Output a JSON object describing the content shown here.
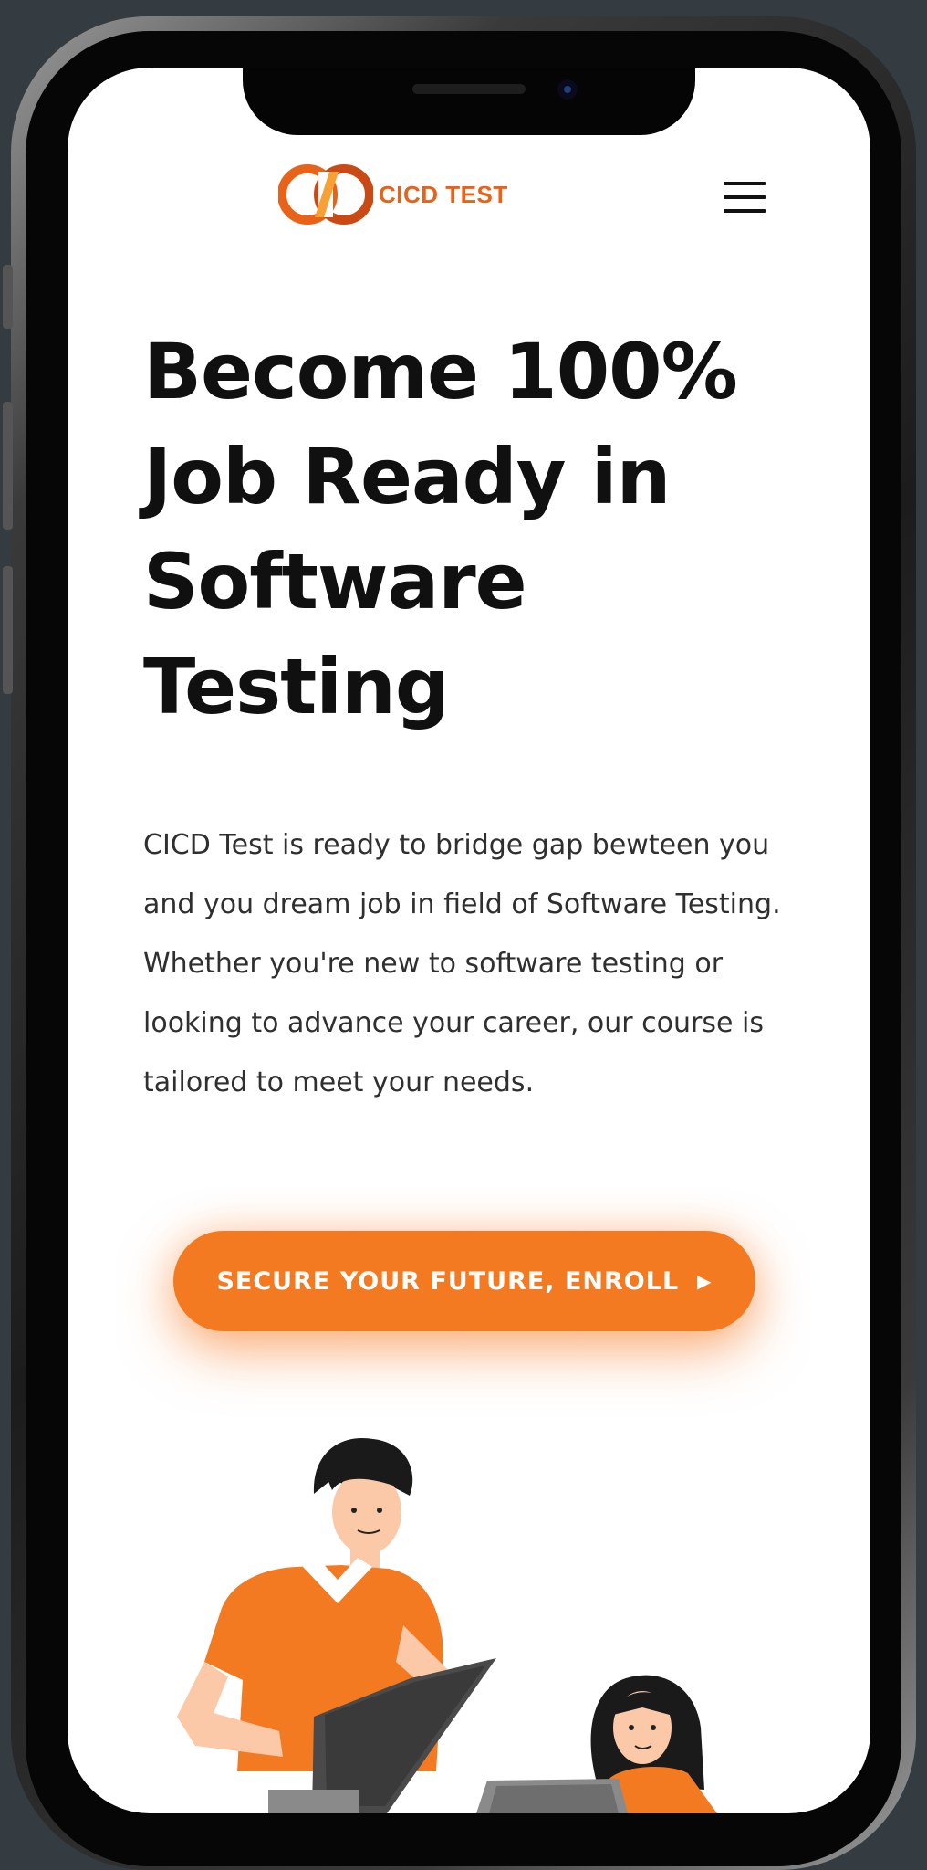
{
  "header": {
    "logo_text": "CICD TEST",
    "menu_icon": "hamburger-menu-icon"
  },
  "hero": {
    "headline": "Become 100% Job Ready in Software Testing",
    "description": "CICD Test is ready to bridge gap bewteen you and you dream job in field of Software Testing. Whether you're new to software testing or looking to advance your career, our course is tailored to meet your needs.",
    "cta_label": "SECURE YOUR FUTURE, ENROLL",
    "cta_icon": "caret-right-icon"
  },
  "colors": {
    "accent": "#f47a22",
    "logo_orange": "#e8621a",
    "text_dark": "#101010",
    "background": "#343c42"
  }
}
